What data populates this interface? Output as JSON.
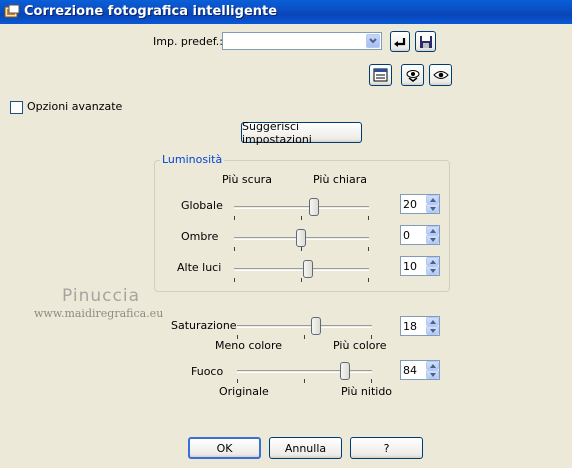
{
  "window": {
    "title": "Correzione fotografica intelligente"
  },
  "presets": {
    "label": "Imp. predef.:",
    "value": ""
  },
  "toolbar_icons": {
    "reset": "reset-arrow-icon",
    "save": "save-disk-icon",
    "preview": "preview-window-icon",
    "toggle_preview": "eye-hand-icon",
    "auto_preview": "eye-icon"
  },
  "advanced": {
    "label": "Opzioni avanzate",
    "checked": false
  },
  "suggest_button": "Suggerisci impostazioni",
  "brightness": {
    "group_label": "Luminosità",
    "darker_label": "Più scura",
    "lighter_label": "Più chiara",
    "rows": [
      {
        "label": "Globale",
        "value": "20"
      },
      {
        "label": "Ombre",
        "value": "0"
      },
      {
        "label": "Alte luci",
        "value": "10"
      }
    ]
  },
  "saturation": {
    "label": "Saturazione",
    "value": "18",
    "min_label": "Meno colore",
    "max_label": "Più colore"
  },
  "focus": {
    "label": "Fuoco",
    "value": "84",
    "min_label": "Originale",
    "max_label": "Più nitido"
  },
  "watermark": {
    "name": "Pinuccia",
    "url": "www.maidiregrafica.eu"
  },
  "buttons": {
    "ok": "OK",
    "cancel": "Annulla",
    "help": "?"
  },
  "colors": {
    "title_bar": "#0a4fc4",
    "background": "#ece9d8",
    "button_border": "#003c74"
  }
}
